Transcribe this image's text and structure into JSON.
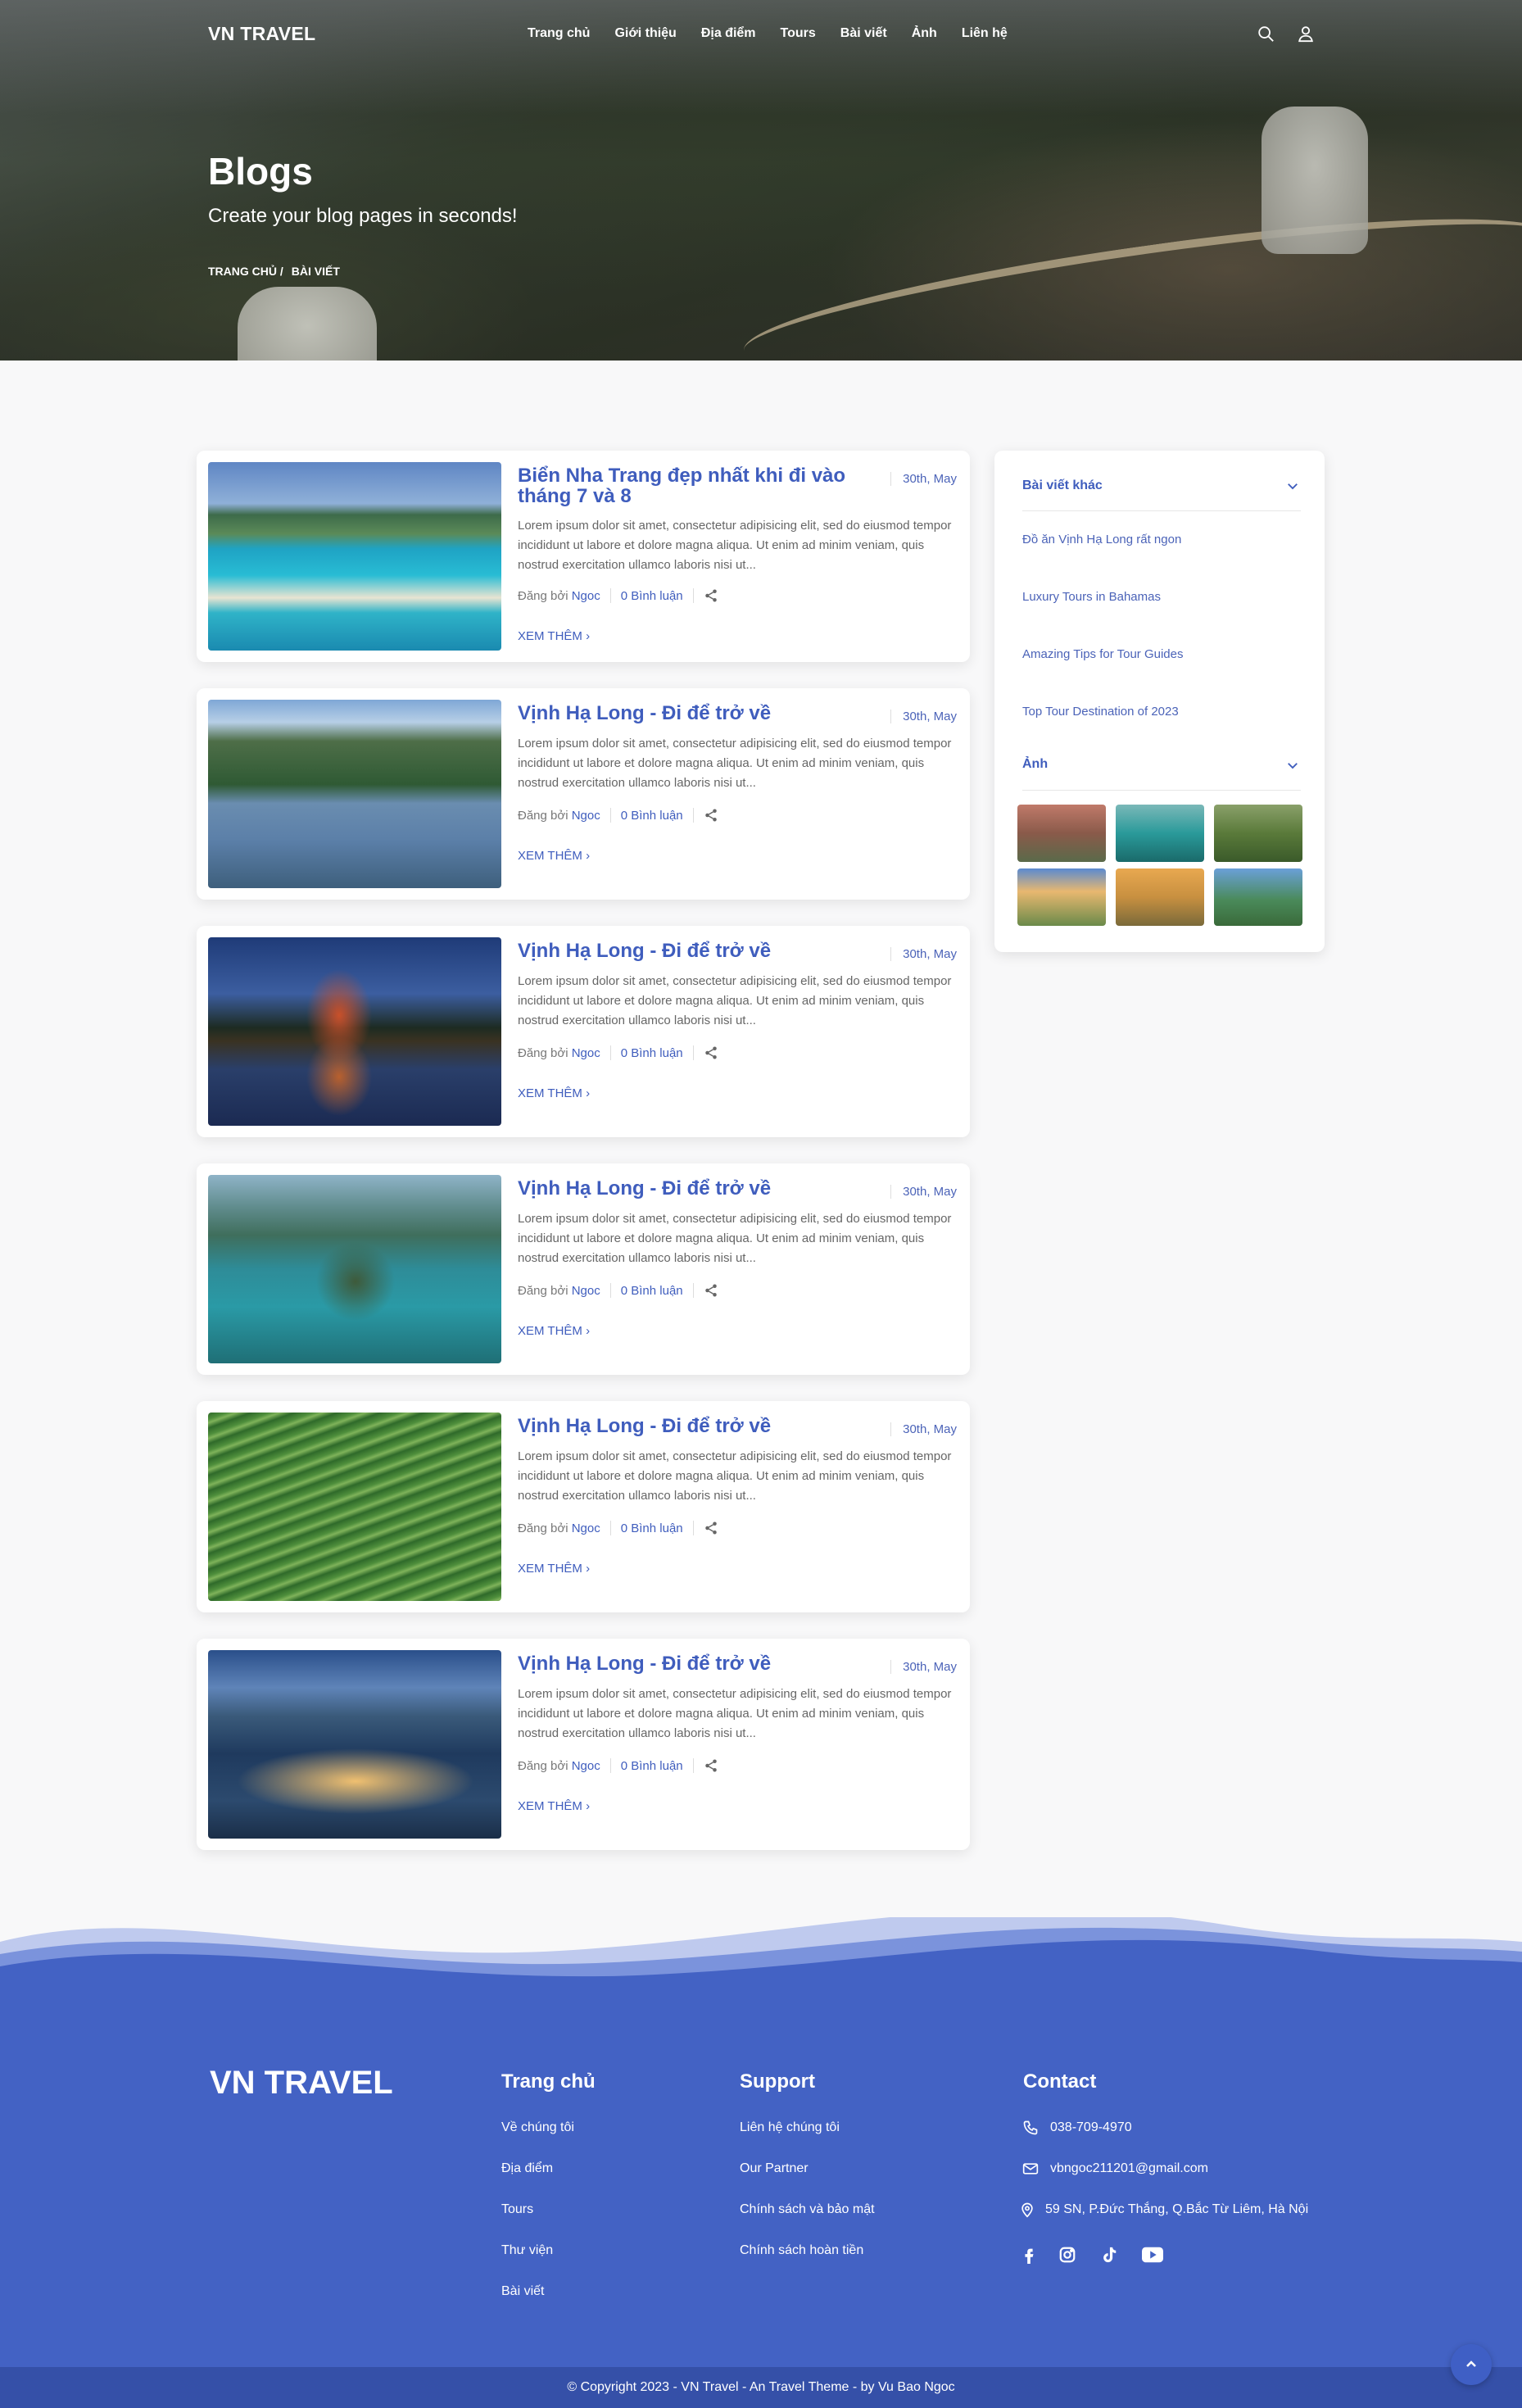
{
  "header": {
    "logo": "VN TRAVEL",
    "nav": [
      "Trang chủ",
      "Giới thiệu",
      "Địa điểm",
      "Tours",
      "Bài viết",
      "Ảnh",
      "Liên hệ"
    ]
  },
  "hero": {
    "title": "Blogs",
    "subtitle": "Create your blog pages in seconds!",
    "breadcrumb": [
      "TRANG CHỦ /",
      "BÀI VIẾT"
    ]
  },
  "posts": [
    {
      "title": "Biển Nha Trang đẹp nhất khi đi vào tháng 7 và 8",
      "date": "30th, May",
      "excerpt": "Lorem ipsum dolor sit amet, consectetur adipisicing elit, sed do eiusmod tempor incididunt ut labore et dolore magna aliqua. Ut enim ad minim veniam, quis nostrud exercitation ullamco laboris nisi ut...",
      "by": "Đăng bởi",
      "author": "Ngoc",
      "comments": "0 Bình luận",
      "more": "XEM THÊM"
    },
    {
      "title": "Vịnh Hạ Long - Đi để trở về",
      "date": "30th, May",
      "excerpt": "Lorem ipsum dolor sit amet, consectetur adipisicing elit, sed do eiusmod tempor incididunt ut labore et dolore magna aliqua. Ut enim ad minim veniam, quis nostrud exercitation ullamco laboris nisi ut...",
      "by": "Đăng bởi",
      "author": "Ngoc",
      "comments": "0 Bình luận",
      "more": "XEM THÊM"
    },
    {
      "title": "Vịnh Hạ Long - Đi để trở về",
      "date": "30th, May",
      "excerpt": "Lorem ipsum dolor sit amet, consectetur adipisicing elit, sed do eiusmod tempor incididunt ut labore et dolore magna aliqua. Ut enim ad minim veniam, quis nostrud exercitation ullamco laboris nisi ut...",
      "by": "Đăng bởi",
      "author": "Ngoc",
      "comments": "0 Bình luận",
      "more": "XEM THÊM"
    },
    {
      "title": "Vịnh Hạ Long - Đi để trở về",
      "date": "30th, May",
      "excerpt": "Lorem ipsum dolor sit amet, consectetur adipisicing elit, sed do eiusmod tempor incididunt ut labore et dolore magna aliqua. Ut enim ad minim veniam, quis nostrud exercitation ullamco laboris nisi ut...",
      "by": "Đăng bởi",
      "author": "Ngoc",
      "comments": "0 Bình luận",
      "more": "XEM THÊM"
    },
    {
      "title": "Vịnh Hạ Long - Đi để trở về",
      "date": "30th, May",
      "excerpt": "Lorem ipsum dolor sit amet, consectetur adipisicing elit, sed do eiusmod tempor incididunt ut labore et dolore magna aliqua. Ut enim ad minim veniam, quis nostrud exercitation ullamco laboris nisi ut...",
      "by": "Đăng bởi",
      "author": "Ngoc",
      "comments": "0 Bình luận",
      "more": "XEM THÊM"
    },
    {
      "title": "Vịnh Hạ Long - Đi để trở về",
      "date": "30th, May",
      "excerpt": "Lorem ipsum dolor sit amet, consectetur adipisicing elit, sed do eiusmod tempor incididunt ut labore et dolore magna aliqua. Ut enim ad minim veniam, quis nostrud exercitation ullamco laboris nisi ut...",
      "by": "Đăng bởi",
      "author": "Ngoc",
      "comments": "0 Bình luận",
      "more": "XEM THÊM"
    }
  ],
  "sidebar": {
    "other_posts_heading": "Bài viết khác",
    "other_posts": [
      "Đồ ăn Vịnh Hạ Long rất ngon",
      "Luxury Tours in Bahamas",
      "Amazing Tips for Tour Guides",
      "Top Tour Destination of 2023"
    ],
    "photos_heading": "Ảnh"
  },
  "footer": {
    "logo": "VN TRAVEL",
    "col1": {
      "heading": "Trang chủ",
      "links": [
        "Về chúng tôi",
        "Địa điểm",
        "Tours",
        "Thư viện",
        "Bài viết"
      ]
    },
    "col2": {
      "heading": "Support",
      "links": [
        "Liên hệ chúng tôi",
        "Our Partner",
        "Chính sách và bảo mật",
        "Chính sách hoàn tiền"
      ]
    },
    "contact": {
      "heading": "Contact",
      "phone": "038-709-4970",
      "email": "vbngoc211201@gmail.com",
      "address": "59 SN, P.Đức Thắng, Q.Bắc Từ Liêm, Hà Nội"
    },
    "social_icons": [
      "facebook-icon",
      "instagram-icon",
      "tiktok-icon",
      "youtube-icon"
    ],
    "copyright": "© Copyright 2023 - VN Travel - An Travel Theme - by Vu Bao Ngoc"
  },
  "colors": {
    "primary": "#3f5dbd",
    "footer_bg": "#4362c4",
    "copyright_bg": "#3550a8"
  }
}
